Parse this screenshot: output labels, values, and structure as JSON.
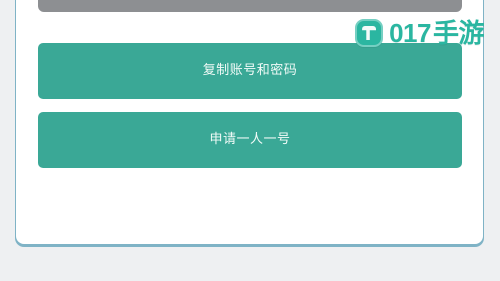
{
  "watermark": {
    "brand": "017",
    "suffix": "手游",
    "icon": "seven-badge-icon"
  },
  "buttons": {
    "top_label": "",
    "copy_label": "复制账号和密码",
    "apply_label": "申请一人一号"
  },
  "colors": {
    "primary": "#3aa896",
    "top_button": "#8d8f92",
    "brand": "#2bb6a1"
  }
}
